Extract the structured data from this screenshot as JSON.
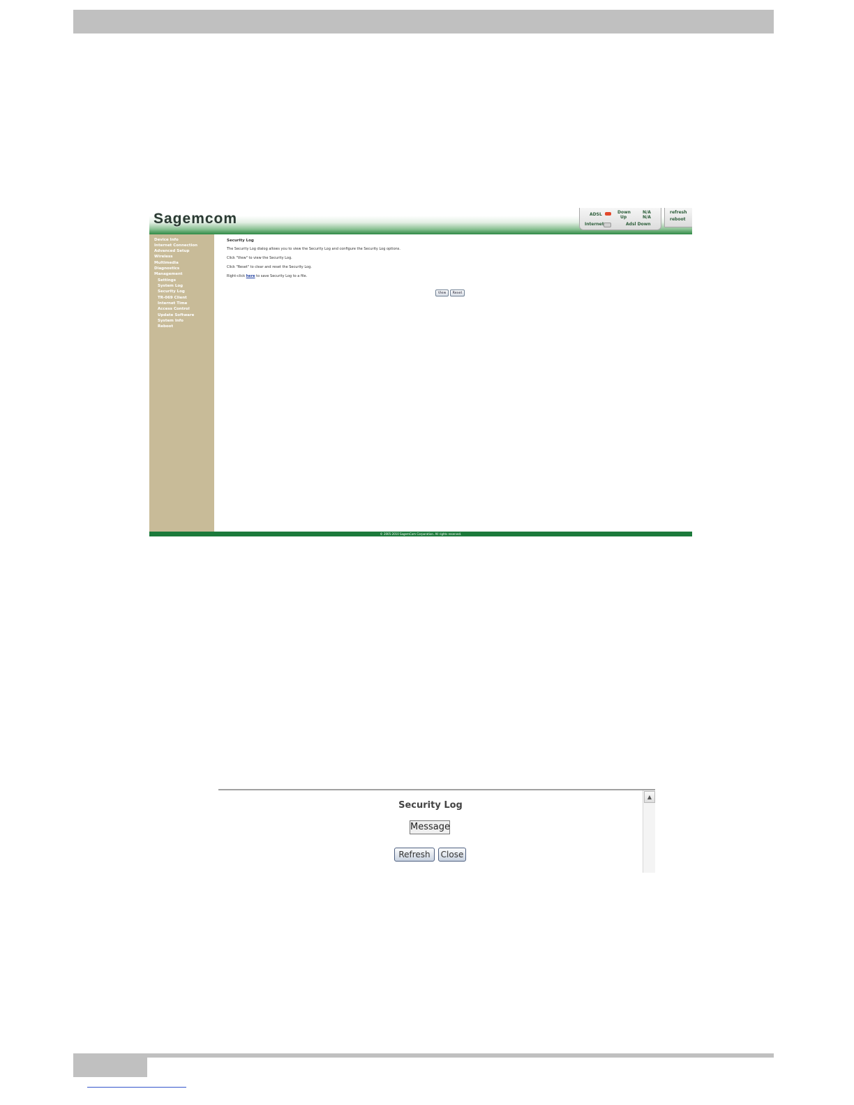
{
  "router": {
    "logo": "Sagemcom",
    "status": {
      "adsl_label": "ADSL",
      "down_label": "Down",
      "down_value": "N/A",
      "up_label": "Up",
      "up_value": "N/A",
      "internet_label": "Internet",
      "adsl_down": "Adsl Down",
      "adsl_led_color": "#e2482b"
    },
    "actions": {
      "refresh": "refresh",
      "reboot": "reboot"
    },
    "sidebar": {
      "items": [
        "Device Info",
        "Internet Connection",
        "Advanced Setup",
        "Wireless",
        "Multimedia",
        "Diagnostics",
        "Management",
        "Settings",
        "System Log",
        "Security Log",
        "TR-069 Client",
        "Internet Time",
        "Access Control",
        "Update Software",
        "System Info",
        "Reboot"
      ]
    },
    "content": {
      "title": "Security Log",
      "desc": "The Security Log dialog allows you to view the Security Log and configure the Security Log options.",
      "view_hint": "Click \"View\" to view the Security Log.",
      "reset_hint": "Click \"Reset\" to clear and reset the Security Log.",
      "save_prefix": "Right-click",
      "save_link": "here",
      "save_suffix": "to save Security Log to a file.",
      "view_button": "View",
      "reset_button": "Reset"
    },
    "footer": "© 2005-2010 SagemCom Corporation. All rights reserved."
  },
  "popup": {
    "title": "Security Log",
    "column_header": "Message",
    "refresh_button": "Refresh",
    "close_button": "Close"
  }
}
